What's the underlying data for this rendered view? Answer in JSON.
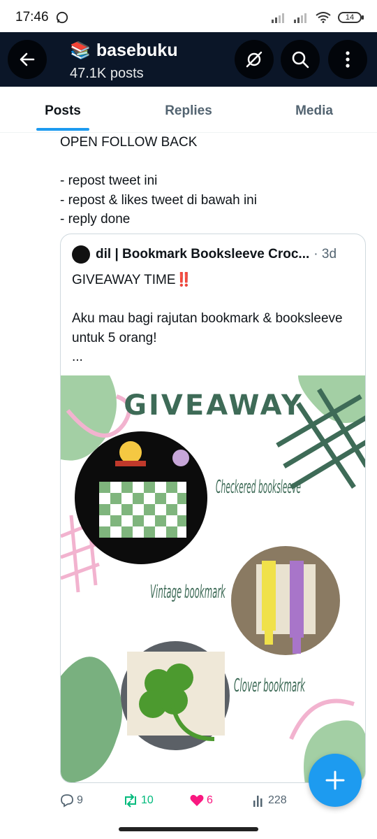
{
  "status": {
    "time": "17:46",
    "battery": "14"
  },
  "header": {
    "account_name": "basebuku",
    "post_count": "47.1K posts"
  },
  "tabs": [
    {
      "label": "Posts"
    },
    {
      "label": "Replies"
    },
    {
      "label": "Media"
    }
  ],
  "tweet": {
    "text": "OPEN FOLLOW BACK\n\n- repost tweet ini\n- repost & likes tweet di bawah ini\n- reply done",
    "quote": {
      "author": "dil | Bookmark Booksleeve Croc...",
      "time": "· 3d",
      "text": "GIVEAWAY TIME‼️\n\nAku mau bagi rajutan bookmark & booksleeve untuk 5 orang!\n...",
      "image": {
        "heading": "GIVEAWAY",
        "items": [
          "Checkered booksleeve",
          "Vintage bookmark",
          "Clover bookmark"
        ]
      }
    },
    "stats": {
      "replies": "9",
      "reposts": "10",
      "likes": "6",
      "views": "228"
    }
  },
  "colors": {
    "accent": "#1d9bf0",
    "repost": "#00ba7c",
    "like": "#f91880",
    "header_bg": "#0b1628"
  },
  "icons": [
    "back-arrow-icon",
    "grok-icon",
    "search-icon",
    "more-icon",
    "reply-icon",
    "repost-icon",
    "heart-icon",
    "views-icon",
    "plus-icon"
  ]
}
